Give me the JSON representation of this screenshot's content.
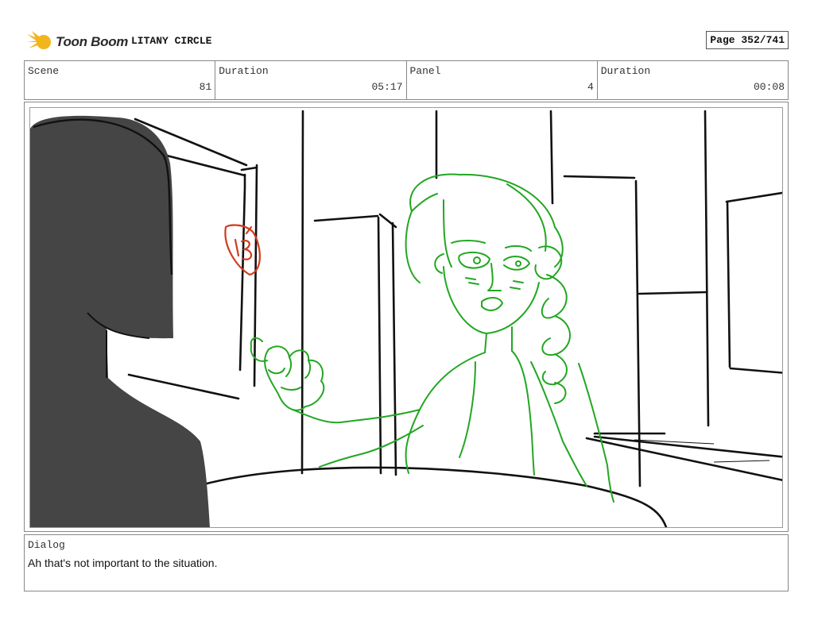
{
  "header": {
    "logo_text": "Toon Boom",
    "project_title": "LITANY CIRCLE",
    "page_label": "Page 352/741"
  },
  "info": {
    "scene_label": "Scene",
    "scene_value": "81",
    "scene_duration_label": "Duration",
    "scene_duration_value": "05:17",
    "panel_label": "Panel",
    "panel_value": "4",
    "panel_duration_label": "Duration",
    "panel_duration_value": "00:08"
  },
  "panel": {
    "colors": {
      "silhouette": "#454545",
      "character_lines": "#22a722",
      "annotation": "#d23c1e",
      "background_lines": "#111111"
    },
    "annotation_mark": "13"
  },
  "dialog": {
    "label": "Dialog",
    "text": "Ah that's not important to the situation."
  }
}
